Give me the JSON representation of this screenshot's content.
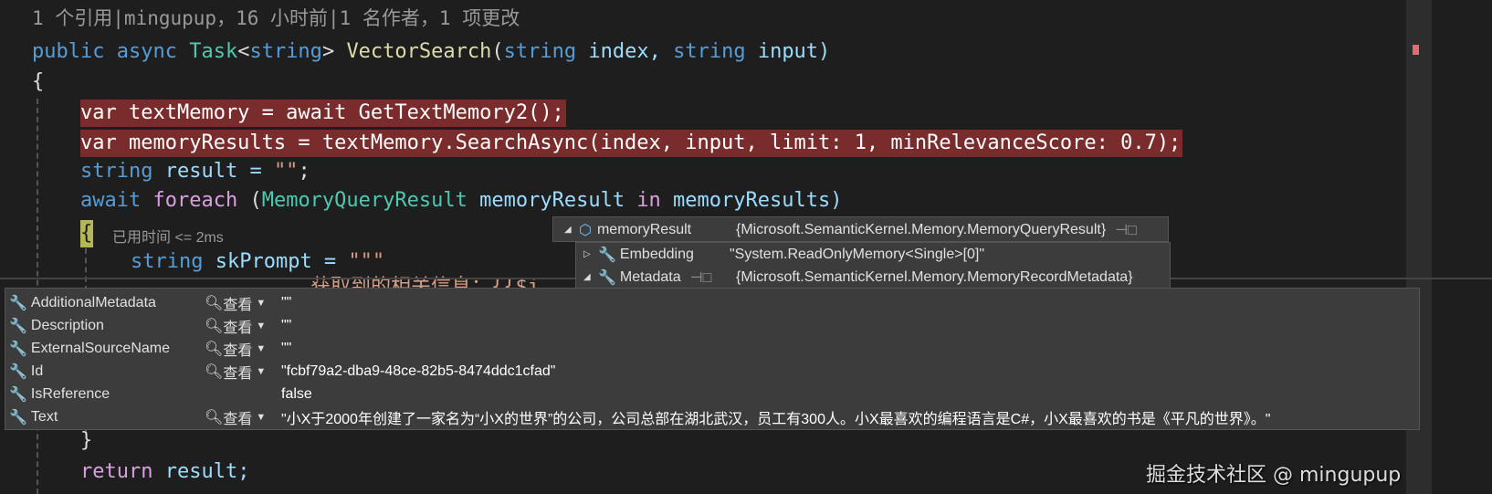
{
  "codelens": "1 个引用|mingupup，16 小时前|1 名作者，1 项更改",
  "code": {
    "l2": [
      "public",
      "async",
      "Task",
      "<",
      "string",
      "> ",
      "VectorSearch",
      "(",
      "string",
      " index, ",
      "string",
      " input)"
    ],
    "l3": "{",
    "l4": "var textMemory = await GetTextMemory2();",
    "l5": "var memoryResults = textMemory.SearchAsync(index, input, limit: 1, minRelevanceScore: 0.7);",
    "l6": [
      "string",
      " result = ",
      "\"\"",
      ";"
    ],
    "l7": [
      "await",
      " ",
      "foreach",
      " (",
      "MemoryQueryResult",
      " memoryResult ",
      "in",
      " memoryResults)"
    ],
    "l8": "{",
    "elapsed": "已用时间 <= 2ms",
    "l9": [
      "string",
      " skPrompt = ",
      "\"\"\""
    ],
    "l10": "获取到的相关信息：{{$i",
    "l_close": "}",
    "l_return": [
      "return",
      " result;"
    ]
  },
  "datatip": {
    "root": {
      "name": "memoryResult",
      "value": "{Microsoft.SemanticKernel.Memory.MemoryQueryResult}"
    },
    "children": [
      {
        "name": "Embedding",
        "value": "\"System.ReadOnlyMemory<Single>[0]\""
      },
      {
        "name": "Metadata",
        "value": "{Microsoft.SemanticKernel.Memory.MemoryRecordMetadata}"
      }
    ],
    "view_label": "查看",
    "metadata": [
      {
        "name": "AdditionalMetadata",
        "value": "\"\"",
        "view": true
      },
      {
        "name": "Description",
        "value": "\"\"",
        "view": true
      },
      {
        "name": "ExternalSourceName",
        "value": "\"\"",
        "view": true
      },
      {
        "name": "Id",
        "value": "\"fcbf79a2-dba9-48ce-82b5-8474ddc1cfad\"",
        "view": true
      },
      {
        "name": "IsReference",
        "value": "false",
        "view": false
      },
      {
        "name": "Text",
        "value": "\"小X于2000年创建了一家名为“小X的世界”的公司，公司总部在湖北武汉，员工有300人。小X最喜欢的编程语言是C#，小X最喜欢的书是《平凡的世界》。\"",
        "view": true
      }
    ]
  },
  "watermark": "掘金技术社区 @ mingupup",
  "colors": {
    "highlight": "#7a2c2c",
    "background": "#1e1e1e"
  }
}
